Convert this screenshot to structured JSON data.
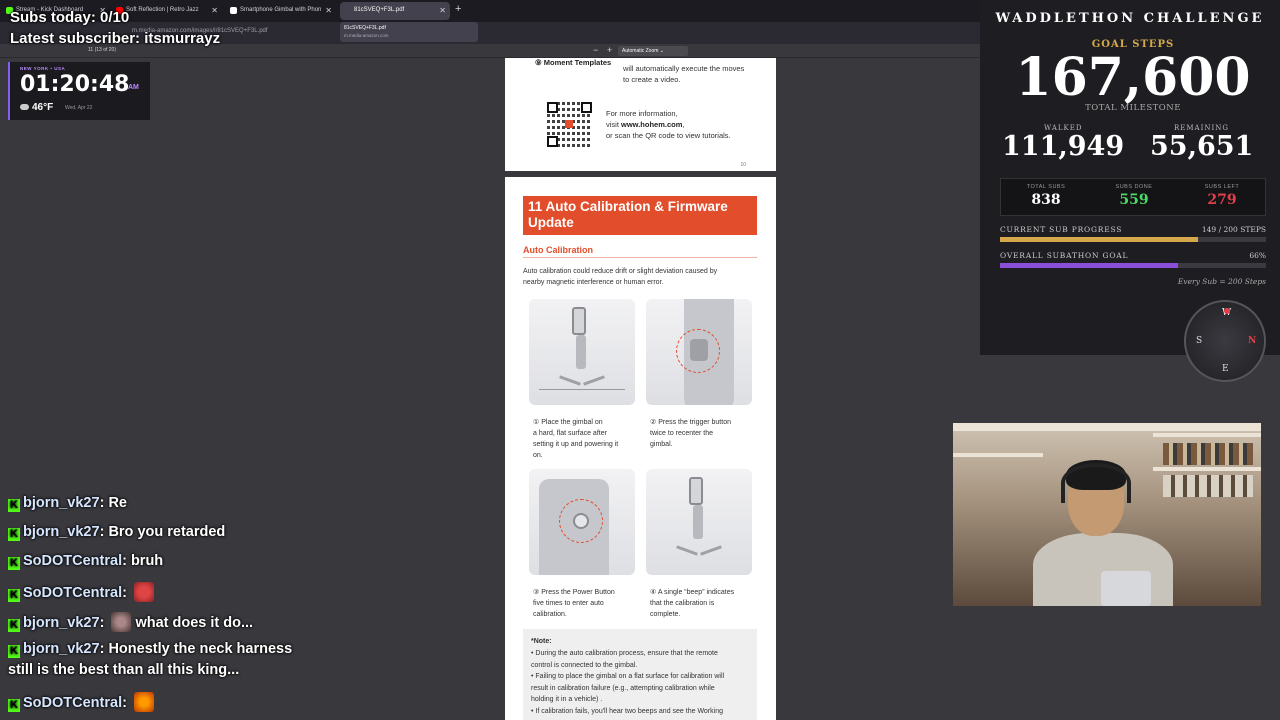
{
  "browser": {
    "tabs": [
      {
        "title": "Stream - Kick Dashboard",
        "fav": "#53fc18"
      },
      {
        "title": "Soft Reflection | Retro Jazz",
        "fav": "#ff0000"
      },
      {
        "title": "Smartphone Gimbal with Phon",
        "fav": "#ffffff"
      },
      {
        "title": "81cSVEQ+F3L.pdf",
        "fav": "#aaaaaa"
      }
    ],
    "url": "m.media-amazon.com/images/I/81cSVEQ+F3L.pdf",
    "preview": {
      "title": "81cSVEQ+F3L.pdf",
      "domain": "m.media-amazon.com"
    },
    "page_current": "11",
    "page_total": "(13 of 20)",
    "zoom": "Automatic Zoom"
  },
  "overlay": {
    "subs_today": "Subs today: 0/10",
    "latest_sub": "Latest subscriber: itsmurrayz"
  },
  "clock": {
    "location": "NEW YORK • USA",
    "time": "01:20:48",
    "ampm": "AM",
    "temp": "46°F",
    "date": "Wed, Apr 22"
  },
  "pdf": {
    "page1": {
      "moment_label": "⑨ Moment Templates",
      "moment_text1": "will automatically execute the moves",
      "moment_text2": "to create a video.",
      "info1": "For more information,",
      "info2_prefix": "visit ",
      "info2_link": "www.hohem.com",
      "info3": "or scan the QR code to view tutorials.",
      "page_number": "10"
    },
    "page2": {
      "header": "11 Auto Calibration & Firmware Update",
      "subheader": "Auto Calibration",
      "intro1": "Auto calibration could reduce drift or slight deviation caused by",
      "intro2": "nearby magnetic interference or human error.",
      "step1": [
        "① Place the gimbal on",
        "a hard, flat surface after",
        "setting it up and powering it",
        "on."
      ],
      "step2": [
        "② Press the trigger button",
        "twice to recenter the",
        "gimbal."
      ],
      "step3": [
        "③ Press the Power Button",
        "five times to enter auto",
        "calibration."
      ],
      "step4": [
        "④ A single “beep” indicates",
        "that the calibration is",
        "complete."
      ],
      "note_title": "*Note:",
      "notes": [
        "• During the auto calibration process, ensure that the remote",
        "  control is connected to the gimbal.",
        "• Failing to place the gimbal on a flat surface for calibration will",
        "  result in calibration failure (e.g., attempting calibration while",
        "  holding it in a vehicle) .",
        "• If calibration fails, you'll hear two beeps and see the Working"
      ]
    }
  },
  "stats": {
    "challenge": "WADDLETHON CHALLENGE",
    "goal_label": "GOAL STEPS",
    "goal_value": "167,600",
    "total_milestone": "TOTAL MILESTONE",
    "walked_label": "WALKED",
    "walked_value": "111,949",
    "remaining_label": "REMAINING",
    "remaining_value": "55,651",
    "total_subs_label": "TOTAL SUBS",
    "total_subs": "838",
    "subs_done_label": "SUBS DONE",
    "subs_done": "559",
    "subs_left_label": "SUBS LEFT",
    "subs_left": "279",
    "current_label": "CURRENT SUB PROGRESS",
    "current_value": "149 / 200 STEPS",
    "current_fraction": 0.745,
    "overall_label": "OVERALL SUBATHON GOAL",
    "overall_value": "66%",
    "overall_fraction": 0.668,
    "every_sub": "Every Sub = 200 Steps",
    "colors": {
      "gold": "#d4a84b",
      "green": "#4cd964",
      "red": "#e0404a",
      "purple": "#8a4fd8"
    }
  },
  "compass": {
    "n": "N",
    "e": "E",
    "s": "S",
    "w": "W"
  },
  "chat": [
    {
      "user": "bjorn_vk27",
      "msg": "Re"
    },
    {
      "user": "bjorn_vk27",
      "msg": "Bro you retarded"
    },
    {
      "user": "SoDOTCentral",
      "msg": "bruh"
    },
    {
      "user": "SoDOTCentral",
      "msg": ""
    },
    {
      "user": "bjorn_vk27",
      "msg": "what does it do..."
    },
    {
      "user": "bjorn_vk27",
      "msg": "Honestly the neck harness"
    },
    {
      "user": "",
      "msg": "still is the best than all this king..."
    },
    {
      "user": "SoDOTCentral",
      "msg": ""
    }
  ]
}
